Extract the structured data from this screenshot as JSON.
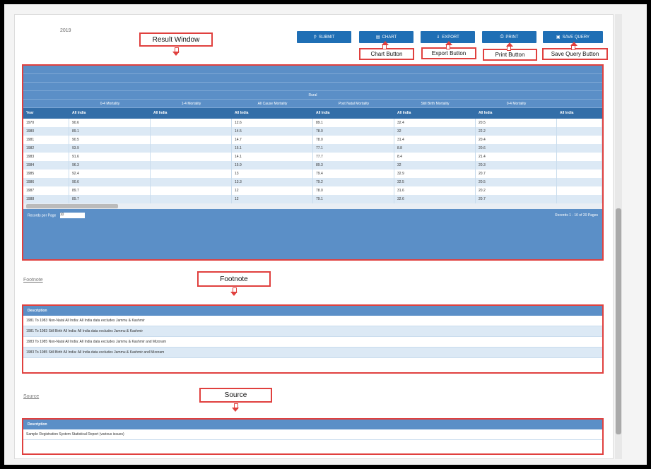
{
  "page": {
    "year_label": "2019"
  },
  "toolbar": {
    "submit_label": "SUBMIT",
    "chart_label": "CHART",
    "export_label": "EXPORT",
    "print_label": "PRINT",
    "save_query_label": "SAVE QUERY"
  },
  "callouts": {
    "result_window": "Result Window",
    "chart_button": "Chart Button",
    "export_button": "Export Button",
    "print_button": "Print Button",
    "save_query_button": "Save Query Button",
    "footnote": "Footnote",
    "source": "Source"
  },
  "result": {
    "title": "Rural",
    "groups": [
      "0-4 Mortality",
      "1-4 Mortality",
      "All Cause Mortality",
      "Post Natal Mortality",
      "Still Birth Mortality",
      "0-4 Mortality"
    ],
    "headers": [
      "Year",
      "All India",
      "All India",
      "All India",
      "All India",
      "All India",
      "All India",
      "All India"
    ],
    "rows": [
      [
        "1970",
        "90.6",
        "",
        "12.6",
        "89.1",
        "32.4",
        "20.5",
        ""
      ],
      [
        "1980",
        "89.1",
        "",
        "14.5",
        "78.0",
        "32",
        "22.2",
        ""
      ],
      [
        "1981",
        "90.5",
        "",
        "14.7",
        "78.0",
        "31.4",
        "20.4",
        ""
      ],
      [
        "1982",
        "93.9",
        "",
        "15.1",
        "77.1",
        "8.8",
        "20.6",
        ""
      ],
      [
        "1983",
        "91.6",
        "",
        "14.1",
        "77.7",
        "8.4",
        "21.4",
        ""
      ],
      [
        "1984",
        "96.3",
        "",
        "15.9",
        "89.3",
        "32",
        "20.3",
        ""
      ],
      [
        "1985",
        "92.4",
        "",
        "13",
        "79.4",
        "32.9",
        "20.7",
        ""
      ],
      [
        "1986",
        "90.6",
        "",
        "13.3",
        "79.2",
        "32.5",
        "20.5",
        ""
      ],
      [
        "1987",
        "89.7",
        "",
        "12",
        "78.0",
        "31.6",
        "20.2",
        ""
      ],
      [
        "1988",
        "89.7",
        "",
        "12",
        "79.1",
        "32.6",
        "20.7",
        ""
      ]
    ],
    "pager_left": "Records per Page",
    "pager_select": "10",
    "pager_right": "Records 1 - 10 of 20  Pages"
  },
  "footnote": {
    "label": "Footnote",
    "header": "Description",
    "rows": [
      "1981 To 1983 Non-Natal All India: All India data excludes Jammu & Kashmir",
      "1981 To 1983 Still Birth All India: All India data excludes Jammu & Kashmir",
      "1983 To 1985 Non-Natal All India: All India data excludes Jammu & Kashmir and Mizoram",
      "1983 To 1985 Still Birth All India: All India data excludes Jammu & Kashmir and Mizoram"
    ]
  },
  "source": {
    "label": "Source",
    "header": "Description",
    "rows": [
      "Sample Registration System Statistical Report (various issues)"
    ]
  }
}
